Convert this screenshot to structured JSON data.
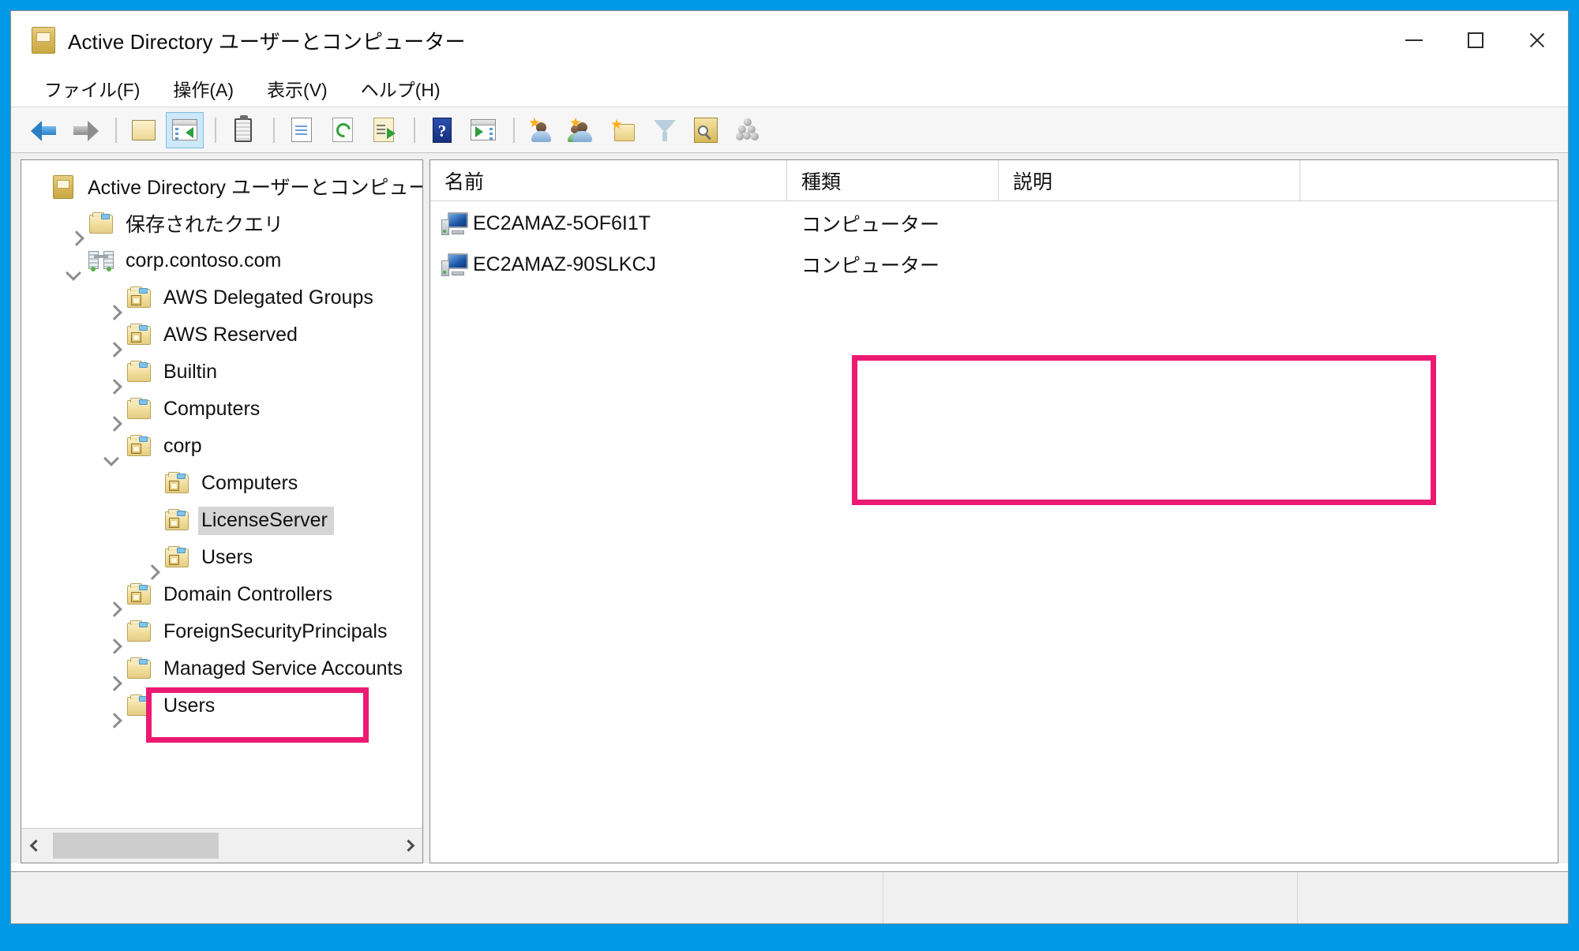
{
  "window": {
    "title": "Active Directory ユーザーとコンピューター",
    "icon": "mmc-console-icon",
    "controls": {
      "minimize": "最小化",
      "maximize": "最大化",
      "close": "閉じる"
    }
  },
  "menubar": {
    "items": [
      {
        "label": "ファイル(F)",
        "name": "menu-file"
      },
      {
        "label": "操作(A)",
        "name": "menu-action"
      },
      {
        "label": "表示(V)",
        "name": "menu-view"
      },
      {
        "label": "ヘルプ(H)",
        "name": "menu-help"
      }
    ]
  },
  "toolbar": {
    "buttons": [
      {
        "icon": "back-arrow-icon",
        "active": false
      },
      {
        "icon": "forward-arrow-icon",
        "active": false
      },
      {
        "icon": "up-one-level-icon",
        "active": false
      },
      {
        "icon": "show-hide-console-tree-icon",
        "active": true
      },
      {
        "icon": "properties-clipboard-icon",
        "active": false
      },
      {
        "icon": "properties-page-icon",
        "active": false
      },
      {
        "icon": "refresh-icon",
        "active": false
      },
      {
        "icon": "export-list-icon",
        "active": false
      },
      {
        "icon": "help-icon",
        "active": false
      },
      {
        "icon": "show-action-pane-icon",
        "active": false
      },
      {
        "icon": "new-user-icon",
        "active": false
      },
      {
        "icon": "new-group-icon",
        "active": false
      },
      {
        "icon": "new-organizational-unit-icon",
        "active": false
      },
      {
        "icon": "filter-funnel-icon",
        "active": false
      },
      {
        "icon": "find-icon",
        "active": false
      },
      {
        "icon": "query-icon",
        "active": false
      }
    ]
  },
  "tree": {
    "nodes": [
      {
        "label": "Active Directory ユーザーとコンピューター",
        "icon": "console-root-icon",
        "indent": 0,
        "expander": "none",
        "selected": false
      },
      {
        "label": "保存されたクエリ",
        "icon": "folder-icon",
        "indent": 1,
        "expander": "collapsed",
        "selected": false
      },
      {
        "label": "corp.contoso.com",
        "icon": "domain-icon",
        "indent": 1,
        "expander": "expanded",
        "selected": false
      },
      {
        "label": "AWS Delegated Groups",
        "icon": "ou-folder-icon",
        "indent": 2,
        "expander": "collapsed",
        "selected": false
      },
      {
        "label": "AWS Reserved",
        "icon": "ou-folder-icon",
        "indent": 2,
        "expander": "collapsed",
        "selected": false
      },
      {
        "label": "Builtin",
        "icon": "folder-icon",
        "indent": 2,
        "expander": "collapsed",
        "selected": false
      },
      {
        "label": "Computers",
        "icon": "folder-icon",
        "indent": 2,
        "expander": "collapsed",
        "selected": false
      },
      {
        "label": "corp",
        "icon": "ou-folder-icon",
        "indent": 2,
        "expander": "expanded",
        "selected": false
      },
      {
        "label": "Computers",
        "icon": "ou-folder-icon",
        "indent": 3,
        "expander": "none",
        "selected": false
      },
      {
        "label": "LicenseServer",
        "icon": "ou-folder-icon",
        "indent": 3,
        "expander": "none",
        "selected": true
      },
      {
        "label": "Users",
        "icon": "ou-folder-icon",
        "indent": 3,
        "expander": "collapsed",
        "selected": false
      },
      {
        "label": "Domain Controllers",
        "icon": "ou-folder-icon",
        "indent": 2,
        "expander": "collapsed",
        "selected": false
      },
      {
        "label": "ForeignSecurityPrincipals",
        "icon": "folder-icon",
        "indent": 2,
        "expander": "collapsed",
        "selected": false
      },
      {
        "label": "Managed Service Accounts",
        "icon": "folder-icon",
        "indent": 2,
        "expander": "collapsed",
        "selected": false
      },
      {
        "label": "Users",
        "icon": "folder-icon",
        "indent": 2,
        "expander": "collapsed",
        "selected": false
      }
    ],
    "hscroll": {
      "left_arrow": "◀",
      "right_arrow": "▶"
    }
  },
  "list": {
    "columns": [
      "名前",
      "種類",
      "説明",
      ""
    ],
    "rows": [
      {
        "name": "EC2AMAZ-5OF6I1T",
        "type": "コンピューター",
        "description": "",
        "icon": "computer-icon"
      },
      {
        "name": "EC2AMAZ-90SLKCJ",
        "type": "コンピューター",
        "description": "",
        "icon": "computer-icon"
      }
    ]
  },
  "statusbar": {
    "cells": [
      "",
      "",
      ""
    ]
  },
  "annotations": {
    "highlight_color": "#ec1a72",
    "boxes": [
      {
        "name": "computer-list-highlight",
        "target": "list-rows"
      },
      {
        "name": "licenseserver-node-highlight",
        "target": "tree-node-licenseserver"
      }
    ]
  },
  "colors": {
    "desktop": "#0099e8",
    "accent": "#ec1a72",
    "selection": "#d5d5d5",
    "toolbar_active": "#cce8f9"
  }
}
